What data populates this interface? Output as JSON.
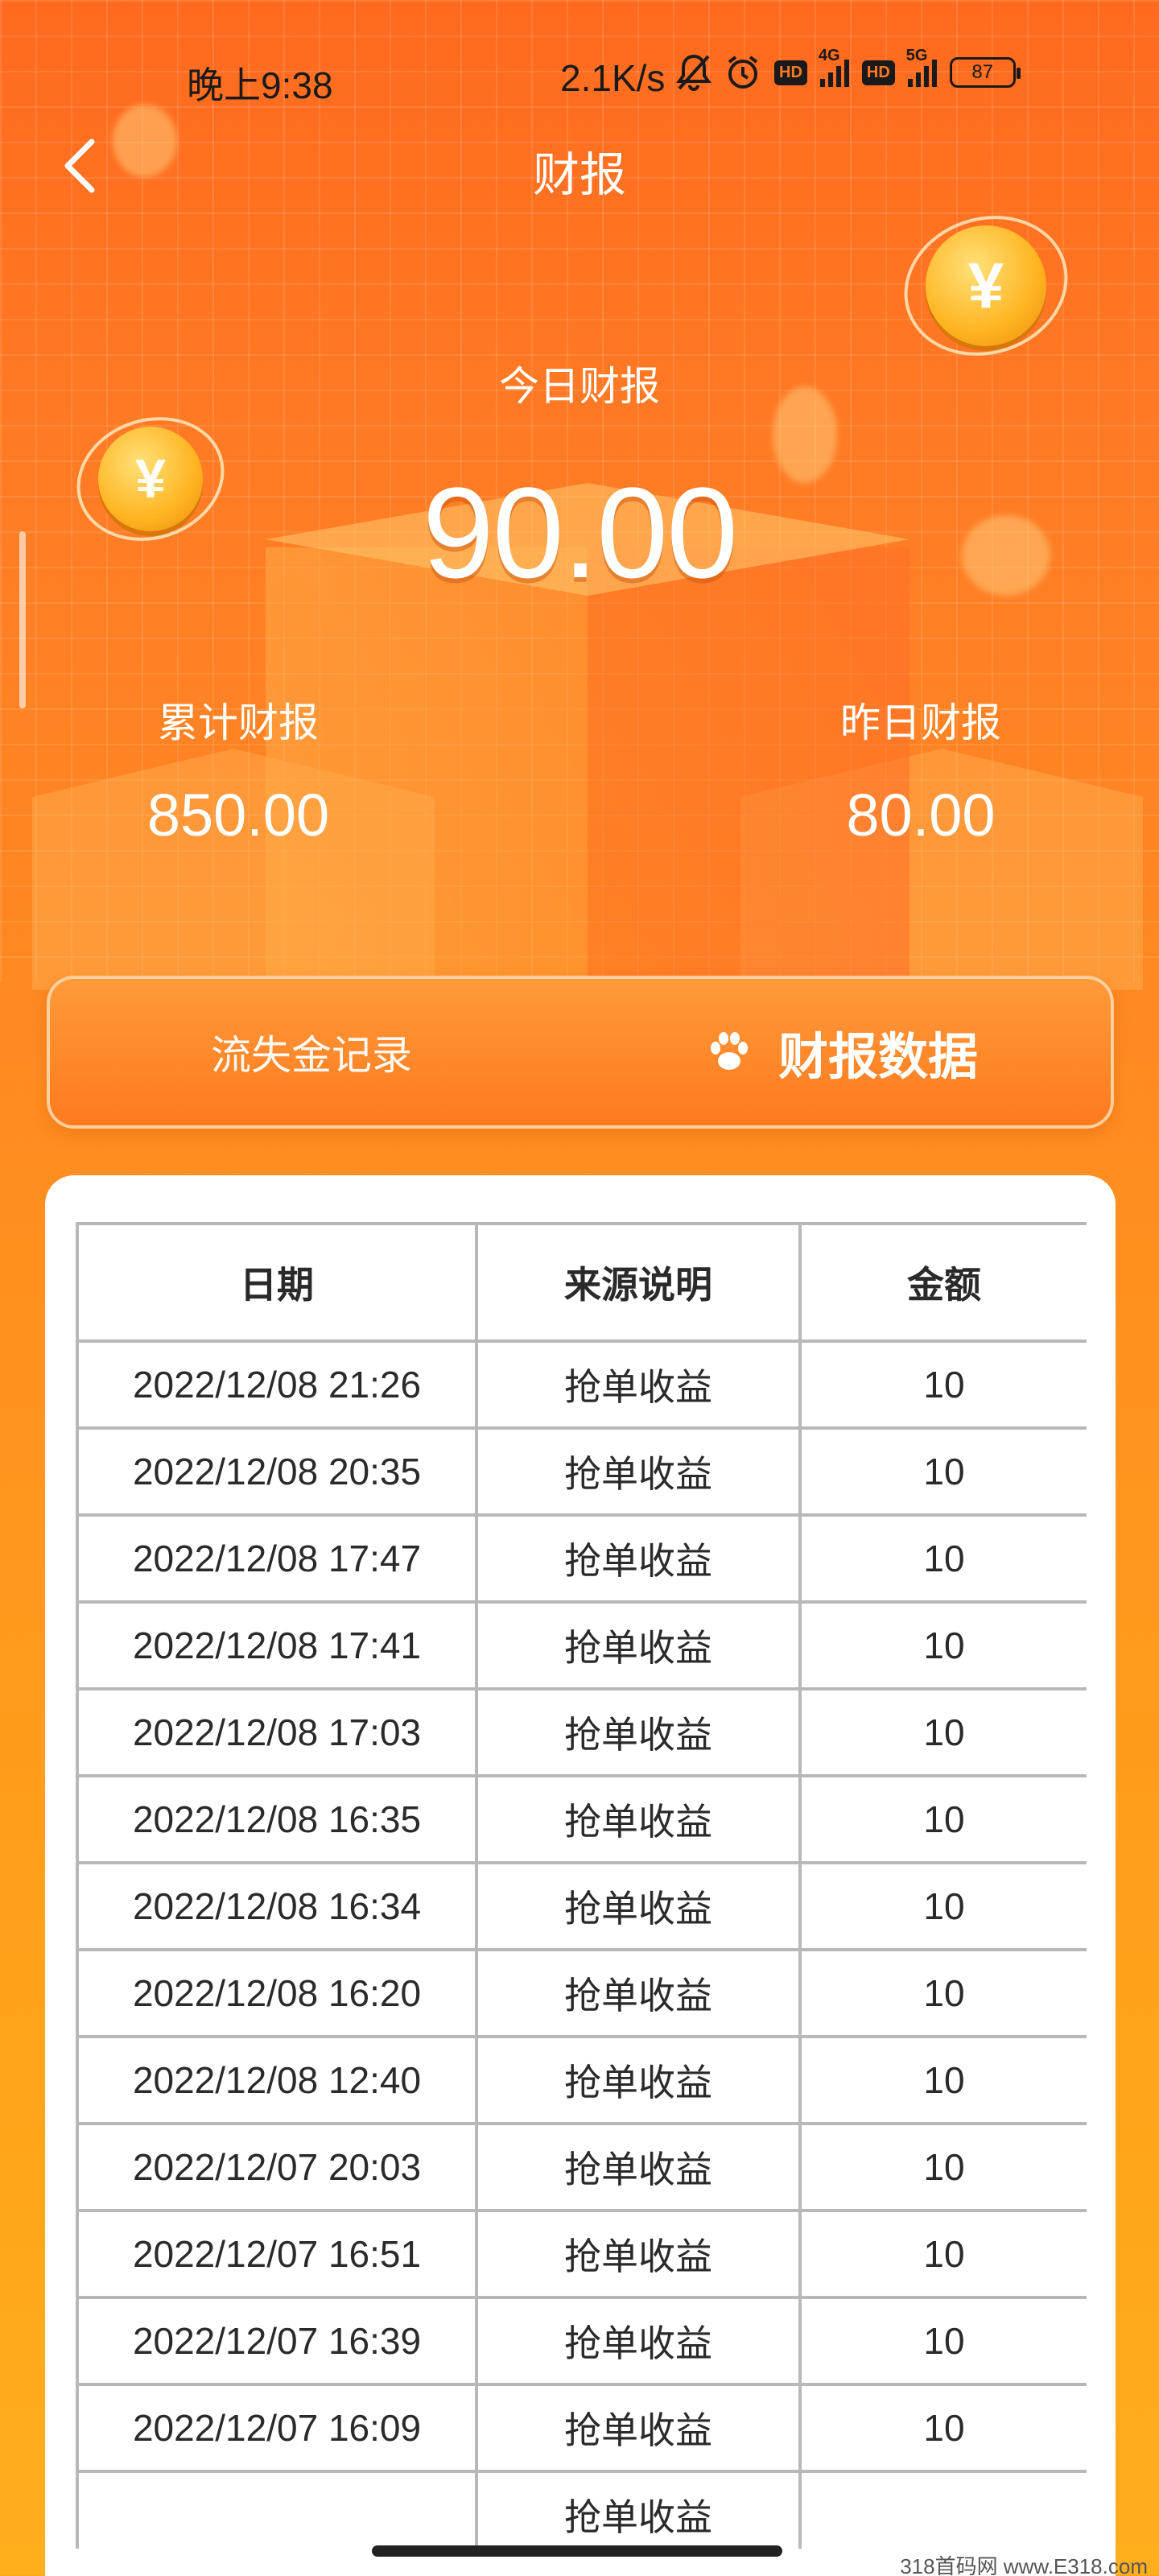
{
  "status_bar": {
    "time": "晚上9:38",
    "speed": "2.1K/s",
    "battery": "87",
    "hd": "HD",
    "net1": "4G",
    "net2": "5G"
  },
  "header": {
    "title": "财报"
  },
  "summary": {
    "today_label": "今日财报",
    "today_value": "90.00",
    "total_label": "累计财报",
    "total_value": "850.00",
    "yesterday_label": "昨日财报",
    "yesterday_value": "80.00"
  },
  "tabs": {
    "loss_label": "流失金记录",
    "data_label": "财报数据"
  },
  "table": {
    "headers": [
      "日期",
      "来源说明",
      "金额"
    ],
    "rows": [
      [
        "2022/12/08 21:26",
        "抢单收益",
        "10"
      ],
      [
        "2022/12/08 20:35",
        "抢单收益",
        "10"
      ],
      [
        "2022/12/08 17:47",
        "抢单收益",
        "10"
      ],
      [
        "2022/12/08 17:41",
        "抢单收益",
        "10"
      ],
      [
        "2022/12/08 17:03",
        "抢单收益",
        "10"
      ],
      [
        "2022/12/08 16:35",
        "抢单收益",
        "10"
      ],
      [
        "2022/12/08 16:34",
        "抢单收益",
        "10"
      ],
      [
        "2022/12/08 16:20",
        "抢单收益",
        "10"
      ],
      [
        "2022/12/08 12:40",
        "抢单收益",
        "10"
      ],
      [
        "2022/12/07 20:03",
        "抢单收益",
        "10"
      ],
      [
        "2022/12/07 16:51",
        "抢单收益",
        "10"
      ],
      [
        "2022/12/07 16:39",
        "抢单收益",
        "10"
      ],
      [
        "2022/12/07 16:09",
        "抢单收益",
        "10"
      ],
      [
        "",
        "抢单收益",
        ""
      ]
    ]
  },
  "watermark": "318首码网  www.E318.com",
  "colors": {
    "accent": "#ff7a1e",
    "background_top": "#ff6a1f",
    "background_bottom": "#ffae1c"
  }
}
